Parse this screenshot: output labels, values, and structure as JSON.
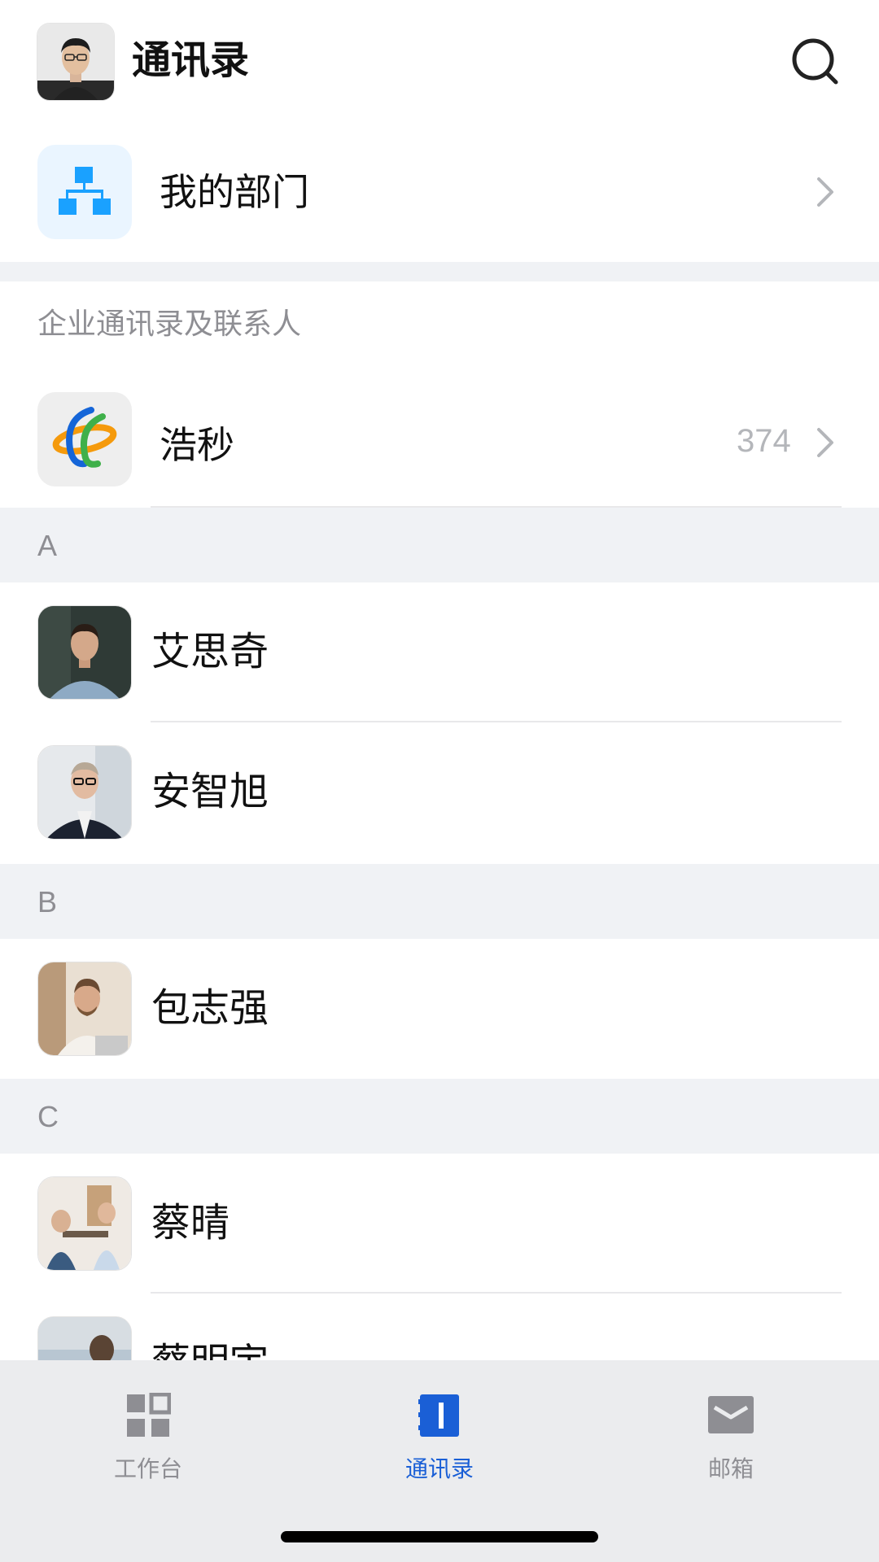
{
  "header": {
    "title": "通讯录",
    "avatar_icon": "user-avatar",
    "search_icon": "search-icon"
  },
  "department": {
    "label": "我的部门",
    "icon": "org-chart-icon",
    "accent": "#1aa1ff"
  },
  "section_title": "企业通讯录及联系人",
  "company": {
    "name": "浩秒",
    "member_count": "374",
    "icon": "company-logo"
  },
  "groups": [
    {
      "letter": "A",
      "contacts": [
        {
          "name": "艾思奇",
          "avatar": "person-photo"
        },
        {
          "name": "安智旭",
          "avatar": "person-photo"
        }
      ]
    },
    {
      "letter": "B",
      "contacts": [
        {
          "name": "包志强",
          "avatar": "person-photo"
        }
      ]
    },
    {
      "letter": "C",
      "contacts": [
        {
          "name": "蔡晴",
          "avatar": "person-photo"
        },
        {
          "name": "蔡明宇",
          "avatar": "person-photo"
        }
      ]
    }
  ],
  "tabbar": {
    "tabs": [
      {
        "label": "工作台",
        "icon": "grid-icon",
        "active": false
      },
      {
        "label": "通讯录",
        "icon": "contacts-book-icon",
        "active": true
      },
      {
        "label": "邮箱",
        "icon": "mail-icon",
        "active": false
      }
    ],
    "active_color": "#1a5fd6",
    "inactive_color": "#8e8e93"
  }
}
